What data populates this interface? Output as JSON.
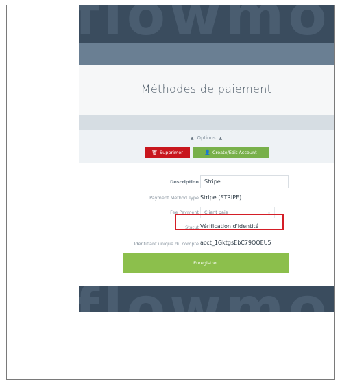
{
  "branding": {
    "watermark_text": "flowmo"
  },
  "page": {
    "title": "Méthodes de paiement"
  },
  "options": {
    "label": "Options",
    "arrow": "▲"
  },
  "actions": {
    "delete_label": "Supprimer",
    "delete_icon": "trash-icon",
    "account_label": "Create/Edit Account",
    "account_icon": "user-icon"
  },
  "form": {
    "description": {
      "label": "Description",
      "value": "Stripe"
    },
    "payment_method_type": {
      "label": "Payment Method Type",
      "value": "Stripe (STRIPE)"
    },
    "fee_payment": {
      "label": "Fee Payment",
      "value": "Client paie"
    },
    "status": {
      "label": "Statut",
      "value": "Vérification d'identité"
    },
    "account_id": {
      "label": "Identifiant unique du compte",
      "value": "acct_1GktgsEbC79OOEU5"
    },
    "save_label": "Enregistrer"
  },
  "colors": {
    "header_dark": "#3a4c5e",
    "nav": "#6a7f93",
    "danger": "#c8161d",
    "success": "#78b04a",
    "save": "#8cbf4c",
    "highlight": "#d41e27"
  }
}
